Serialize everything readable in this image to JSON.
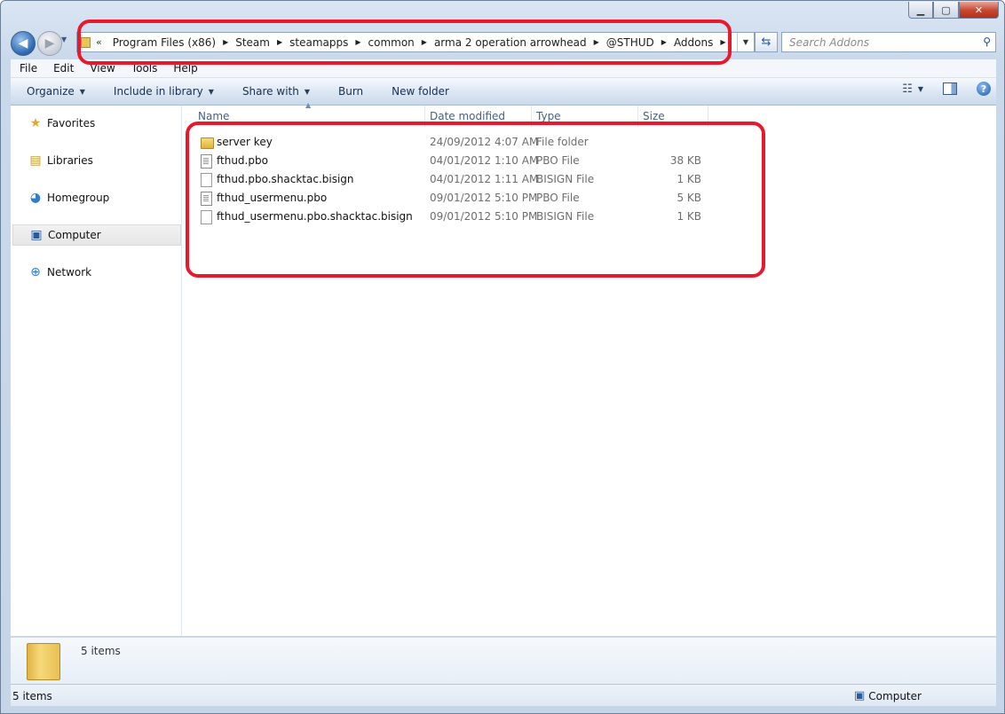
{
  "window": {
    "caption_min": "▁",
    "caption_max": "▢",
    "caption_close": "✕"
  },
  "address_bar": {
    "overflow": "«",
    "breadcrumbs": [
      "Program Files (x86)",
      "Steam",
      "steamapps",
      "common",
      "arma 2 operation arrowhead",
      "@STHUD",
      "Addons"
    ]
  },
  "search": {
    "placeholder": "Search Addons"
  },
  "menu": [
    "File",
    "Edit",
    "View",
    "Tools",
    "Help"
  ],
  "toolbar": {
    "organize": "Organize",
    "include_in_library": "Include in library",
    "share_with": "Share with",
    "burn": "Burn",
    "new_folder": "New folder"
  },
  "nav_pane": {
    "items": [
      {
        "label": "Favorites",
        "icon": "star-icon"
      },
      {
        "label": "Libraries",
        "icon": "libraries-icon"
      },
      {
        "label": "Homegroup",
        "icon": "homegroup-icon"
      },
      {
        "label": "Computer",
        "icon": "computer-icon",
        "selected": true
      },
      {
        "label": "Network",
        "icon": "network-icon"
      }
    ]
  },
  "columns": [
    "Name",
    "Date modified",
    "Type",
    "Size"
  ],
  "files": [
    {
      "name": "server key",
      "date": "24/09/2012 4:07 AM",
      "type": "File folder",
      "size": "",
      "icon": "folder-icon"
    },
    {
      "name": "fthud.pbo",
      "date": "04/01/2012 1:10 AM",
      "type": "PBO File",
      "size": "38 KB",
      "icon": "file-icon"
    },
    {
      "name": "fthud.pbo.shacktac.bisign",
      "date": "04/01/2012 1:11 AM",
      "type": "BISIGN File",
      "size": "1 KB",
      "icon": "file-icon"
    },
    {
      "name": "fthud_usermenu.pbo",
      "date": "09/01/2012 5:10 PM",
      "type": "PBO File",
      "size": "5 KB",
      "icon": "file-icon"
    },
    {
      "name": "fthud_usermenu.pbo.shacktac.bisign",
      "date": "09/01/2012 5:10 PM",
      "type": "BISIGN File",
      "size": "1 KB",
      "icon": "file-icon"
    }
  ],
  "details": {
    "count": "5 items"
  },
  "status": {
    "left": "5 items",
    "right": "Computer"
  },
  "colors": {
    "highlight": "#e8192c",
    "accent": "#2f6cb5"
  }
}
